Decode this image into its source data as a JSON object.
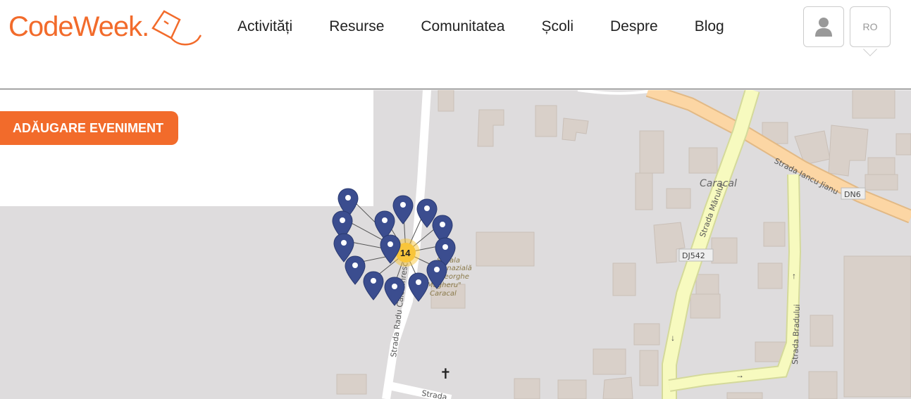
{
  "logo": {
    "text": "CodeWeek."
  },
  "nav": {
    "items": [
      {
        "label": "Activități"
      },
      {
        "label": "Resurse"
      },
      {
        "label": "Comunitatea"
      },
      {
        "label": "Școli"
      },
      {
        "label": "Despre"
      },
      {
        "label": "Blog"
      }
    ]
  },
  "header": {
    "user_icon": "user-icon",
    "language": "RO"
  },
  "actions": {
    "add_event_label": "ADĂUGARE EVENIMENT"
  },
  "map": {
    "cluster_count": "14",
    "labels": {
      "city": "Caracal",
      "street_marului": "Strada Mărului",
      "street_iancu": "Strada Iancu Jianu",
      "dn6": "DN6",
      "dj542": "DJ542",
      "street_radu": "Strada Radu Calomfirescu",
      "street_bradului": "Strada Bradului",
      "school_line1": "Școala",
      "school_line2": "Gimnazială",
      "school_line3": "\"Gheorghe",
      "school_line4": "Magheru\"",
      "school_line5": "Caracal",
      "street_bottom": "Strada"
    },
    "colors": {
      "land": "#dedcdd",
      "building": "#d9d0c9",
      "road_primary": "#fcd6a4",
      "road_secondary": "#f7fabf",
      "marker": "#3b4d8f",
      "cluster": "#f8c53a"
    }
  }
}
